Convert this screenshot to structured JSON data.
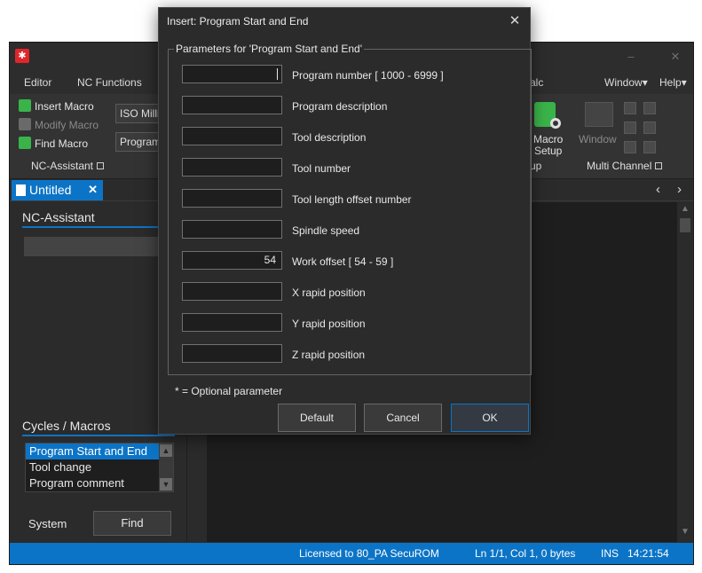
{
  "app": {
    "menu": [
      "Editor",
      "NC Functions",
      "alc",
      "Window",
      "Help"
    ],
    "ribbon": {
      "insert_macro": "Insert Macro",
      "modify_macro": "Modify Macro",
      "find_macro": "Find Macro",
      "group_label": "NC-Assistant",
      "combo_1": "ISO Millin",
      "combo_2": "Program",
      "macro_setup": "Macro\nSetup",
      "macro_setup_group": "up",
      "window_btn": "Window",
      "multi_channel_group": "Multi Channel"
    },
    "tab": {
      "title": "Untitled"
    },
    "panel": {
      "nc_assistant_title": "NC-Assistant",
      "cycles_title": "Cycles / Macros",
      "list": [
        "Program Start and End",
        "Tool change",
        "Program comment"
      ],
      "selected_index": 0,
      "system_label": "System",
      "find_button": "Find"
    },
    "status": {
      "license": "Licensed to 80_PA SecuROM",
      "position": "Ln 1/1, Col 1, 0 bytes",
      "mode": "INS",
      "time": "14:21:54"
    }
  },
  "dialog": {
    "title": "Insert: Program Start and End",
    "legend": "Parameters for 'Program Start and End'",
    "params": [
      {
        "label": "Program number  [ 1000 - 6999 ]",
        "value": ""
      },
      {
        "label": "Program description",
        "value": ""
      },
      {
        "label": "Tool description",
        "value": ""
      },
      {
        "label": "Tool number",
        "value": ""
      },
      {
        "label": "Tool length offset number",
        "value": ""
      },
      {
        "label": "Spindle speed",
        "value": ""
      },
      {
        "label": "Work offset  [ 54 - 59 ]",
        "value": "54"
      },
      {
        "label": "X rapid position",
        "value": ""
      },
      {
        "label": "Y rapid position",
        "value": ""
      },
      {
        "label": "Z rapid position",
        "value": ""
      }
    ],
    "optional_note": "*  =  Optional parameter",
    "buttons": {
      "default": "Default",
      "cancel": "Cancel",
      "ok": "OK"
    }
  }
}
